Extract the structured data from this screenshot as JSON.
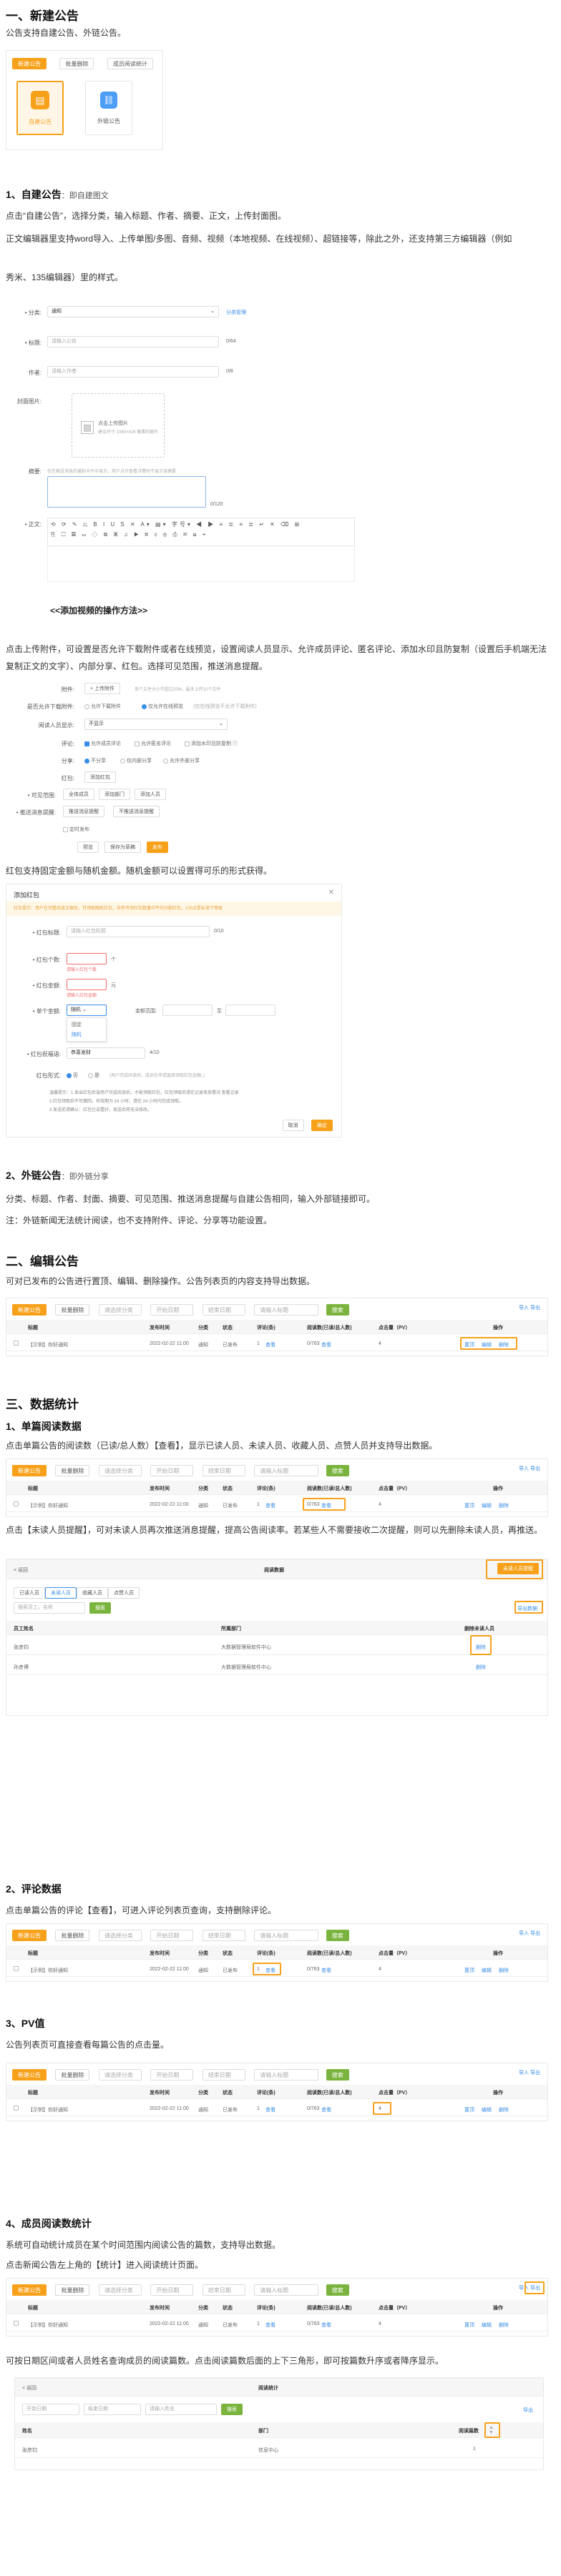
{
  "s1": {
    "title": "一、新建公告",
    "intro": "公告支持自建公告、外链公告。",
    "toolbar": [
      "新建公告",
      "批量删除",
      "成员阅读统计"
    ],
    "cards": [
      "自建公告",
      "外链公告"
    ],
    "h": "1、自建公告",
    "hs": "：即自建图文",
    "p1": "点击“自建公告”，选择分类，输入标题、作者、摘要、正文，上传封面图。",
    "p2": "正文编辑器里支持word导入、上传单图/多图、音频、视频（本地视频、在线视频）、超链接等，除此之外，还支持第三方编辑器（例如",
    "p3": "秀米、135编辑器）里的样式。",
    "form": {
      "cat_label": "• 分类:",
      "cat_val": "通知",
      "cat_link": "分类管理",
      "title_label": "• 标题:",
      "title_ph": "请输入公告",
      "title_cnt": "0/64",
      "author_label": "作者:",
      "author_ph": "请输入作者",
      "author_cnt": "0/8",
      "cover_label": "封面图片:",
      "cover_tip": "点击上传图片",
      "cover_hint": "建议尺寸 1080×426 像素的图片",
      "sum_label": "摘要:",
      "sum_tip": "仅在推送消息的通知卡片中显示，用户点开查看详情时不显示该摘要",
      "sum_cnt": "0/120",
      "body_label": "• 正文:",
      "toolbar_font": "字号"
    },
    "video_link": "<<添加视频的操作方法>>",
    "p4": "点击上传附件，可设置是否允许下载附件或者在线预览，设置阅读人员显示、允许成员评论、匿名评论、添加水印且防复制（设置后手机端无法复制正文的文字）、内部分享、红包。选择可见范围，推送消息提醒。",
    "opts": {
      "attach_l": "附件:",
      "attach_btn": "+ 上传附件",
      "attach_hint": "单个文件大小不超过20M，最多上传10个文件",
      "dl_l": "是否允许下载附件:",
      "dl_a": "允许下载附件",
      "dl_b": "仅允许在线预览",
      "dl_note": "(仅在线预览不允许下载附件)",
      "reader_l": "阅读人员显示:",
      "reader_v": "不显示",
      "cmt_l": "评论:",
      "cmt_a": "允许成员评论",
      "cmt_b": "允许匿名评论",
      "wm_l": "",
      "wm_a": "添加水印且防复制",
      "share_l": "分享:",
      "share_a": "不分享",
      "share_b": "仅内部分享",
      "share_c": "允许外部分享",
      "rp_l": "红包:",
      "rp_btn": "添加红包",
      "vis_l": "• 可见范围:",
      "vis_a": "全体成员",
      "vis_b": "添加部门",
      "vis_c": "添加人员",
      "push_l": "• 推送消息提醒:",
      "push_a": "推送消息提醒",
      "push_b": "不推送消息提醒",
      "timer": "定时发布",
      "btns": [
        "预览",
        "保存为草稿",
        "发布"
      ]
    },
    "p5": "红包支持固定金额与随机金额。随机金额可以设置得可乐的形式获得。",
    "rp": {
      "title": "添加红包",
      "warn": "红包提示：用户在完整阅读文章后，可领取随机红包，共有可领红包数量中平均分配红包，100点是标准下等级",
      "name_l": "• 红包标题:",
      "name_ph": "请输入红包标题",
      "name_cnt": "0/10",
      "cnt_l": "• 红包个数:",
      "cnt_unit": "个",
      "cnt_err": "请输入红包个数",
      "amt_l": "• 红包金额:",
      "amt_unit": "元",
      "amt_err": "请输入红包金额",
      "rule_l": "• 单个金额:",
      "rule_v": "随机",
      "rule_opts": [
        "固定",
        "随机"
      ],
      "range_l": "金额范围:",
      "range_to": "至",
      "wish_l": "• 红包祝福语:",
      "wish_v": "恭喜发财",
      "wish_cnt": "4/10",
      "show_l": "红包形式:",
      "show_a": "否",
      "show_b": "是",
      "show_note": "(用户完成阅读后，成员在申请直接领取红包金额。)",
      "notes": [
        "温馨提示：1.发出红包后该用户完成阅读后，才能领取红包，红包领取后请在记录发放情况 查看记录",
        "2.红包领取后不可撤回，有效期为 24 小时，请在 24 小时内完成领取。",
        "3.发送前请确认：红包已设置好，发送后将无法修改。"
      ],
      "btns": [
        "取消",
        "确定"
      ]
    },
    "h2": "2、外链公告",
    "h2s": "：即外链分享",
    "p6": "分类、标题、作者、封面、摘要、可见范围、推送消息提醒与自建公告相同，输入外部链接即可。",
    "p7": "注：外链新闻无法统计阅读，也不支持附件、评论、分享等功能设置。"
  },
  "s2": {
    "title": "二、编辑公告",
    "p": "可对已发布的公告进行置顶、编辑、删除操作。公告列表页的内容支持导出数据。"
  },
  "list": {
    "toolbar": [
      "新建公告",
      "批量删除",
      "请选择分类",
      "开始日期",
      "结束日期",
      "请输入标题",
      "搜索"
    ],
    "tr": [
      "导入",
      "导出"
    ],
    "cols": [
      "标题",
      "发布时间",
      "状态",
      "评论(条)",
      "阅读数(已读/总人数)",
      "点击量（PV）",
      "操作"
    ],
    "row": [
      "【示例】你好通知",
      "2022-02-22 11:00",
      "通知",
      "已发布",
      "1",
      "查看",
      "0/763",
      "查看",
      "4"
    ],
    "ops": [
      "置顶",
      "编辑",
      "删除"
    ],
    "cols_cat": "分类"
  },
  "s3": {
    "title": "三、数据统计",
    "h1": "1、单篇阅读数据",
    "p1": "点击单篇公告的阅读数（已读/总人数）【查看】，显示已读人员、未读人员、收藏人员、点赞人员并支持导出数据。",
    "p2": "点击【未读人员提醒】，可对未读人员再次推送消息提醒，提高公告阅读率。若某些人不需要接收二次提醒，则可以先删除未读人员，再推送。",
    "read": {
      "back": "< 返回",
      "title": "阅读数据",
      "remind": "未读人员提醒",
      "tabs": [
        "已读人员",
        "未读人员",
        "收藏人员",
        "点赞人员"
      ],
      "search_ph": "搜索员工，名称",
      "search_btn": "搜索",
      "export": "导出数据",
      "cols": [
        "员工姓名",
        "所属部门",
        "删除未读人员"
      ],
      "rows": [
        [
          "张彦钧",
          "大数据管理局软件中心"
        ],
        [
          "孙彦博",
          "大数据管理局软件中心"
        ]
      ],
      "del": "删除"
    },
    "h2": "2、评论数据",
    "p3": "点击单篇公告的评论【查看】，可进入评论列表页查询，支持删除评论。",
    "h3": "3、PV值",
    "p4": "公告列表页可直接查看每篇公告的点击量。",
    "h4": "4、成员阅读数统计",
    "p5": "系统可自动统计成员在某个时间范围内阅读公告的篇数，支持导出数据。",
    "p6": "点击新闻公告左上角的【统计】进入阅读统计页面。",
    "p7": "可按日期区间或者人员姓名查询成员的阅读篇数。点击阅读篇数后面的上下三角形，即可按篇数升序或者降序显示。",
    "stat": {
      "back": "< 返回",
      "title": "阅读统计",
      "start": "开始日期",
      "end": "结束日期",
      "name_ph": "请输入姓名",
      "search": "搜索",
      "export": "导出",
      "cols": [
        "姓名",
        "部门",
        "阅读篇数"
      ],
      "rows": [
        [
          "张彦钧",
          "信息中心",
          "1"
        ]
      ]
    }
  }
}
